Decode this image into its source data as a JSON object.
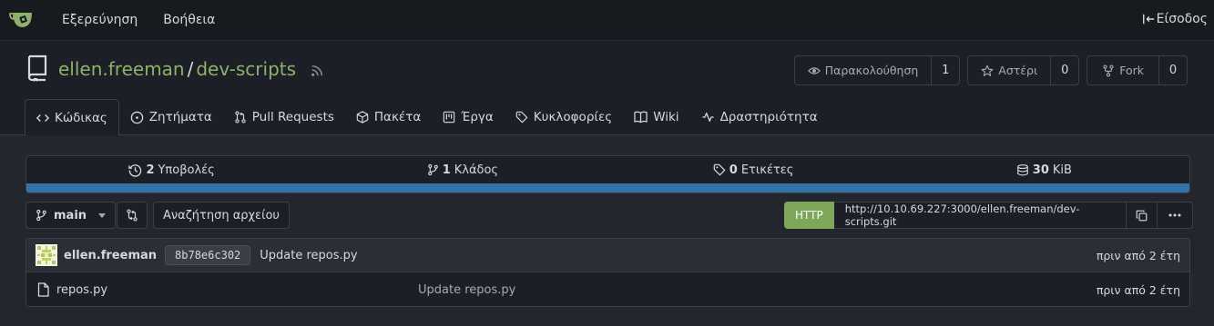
{
  "nav": {
    "explore": "Εξερεύνηση",
    "help": "Βοήθεια",
    "signin": "Είσοδος"
  },
  "repo": {
    "owner": "ellen.freeman",
    "separator": "/",
    "name": "dev-scripts",
    "actions": {
      "watch_label": "Παρακολούθηση",
      "watch_count": "1",
      "star_label": "Αστέρι",
      "star_count": "0",
      "fork_label": "Fork",
      "fork_count": "0"
    }
  },
  "tabs": [
    {
      "label": "Κώδικας",
      "icon": "code-icon",
      "active": true
    },
    {
      "label": "Ζητήματα",
      "icon": "issue-icon"
    },
    {
      "label": "Pull Requests",
      "icon": "pull-request-icon"
    },
    {
      "label": "Πακέτα",
      "icon": "package-icon"
    },
    {
      "label": "Έργα",
      "icon": "project-icon"
    },
    {
      "label": "Κυκλοφορίες",
      "icon": "tag-icon"
    },
    {
      "label": "Wiki",
      "icon": "book-icon"
    },
    {
      "label": "Δραστηριότητα",
      "icon": "pulse-icon"
    }
  ],
  "stats": {
    "commits_count": "2",
    "commits_label": "Υποβολές",
    "branches_count": "1",
    "branches_label": "Κλάδος",
    "tags_count": "0",
    "tags_label": "Ετικέτες",
    "size_count": "30",
    "size_label": "KiB",
    "language_color": "#3572a5"
  },
  "toolbar": {
    "branch": "main",
    "find_file": "Αναζήτηση αρχείου",
    "clone_protocol": "HTTP",
    "clone_url": "http://10.10.69.227:3000/ellen.freeman/dev-scripts.git"
  },
  "latest_commit": {
    "author": "ellen.freeman",
    "sha": "8b78e6c302",
    "message": "Update repos.py",
    "when": "πριν από 2 έτη"
  },
  "files": [
    {
      "name": "repos.py",
      "message": "Update repos.py",
      "when": "πριν από 2 έτη"
    }
  ],
  "colors": {
    "accent_link": "#8fb26b",
    "http_button": "#7ea75a"
  }
}
